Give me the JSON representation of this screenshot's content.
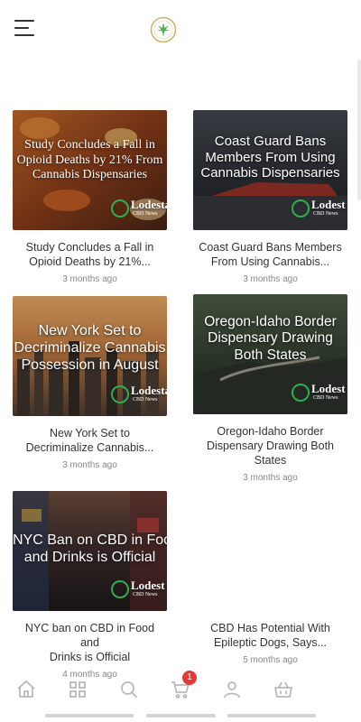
{
  "colors": {
    "accent": "#2fae4f",
    "badge": "#e53935",
    "icon": "#b9b9b9"
  },
  "header": {
    "menu_icon": "hamburger-menu-icon",
    "logo_icon": "cannabis-leaf-logo-icon"
  },
  "articles": [
    {
      "image_text": [
        "Study Concludes a Fall in",
        "Opioid Deaths by 21% From",
        "Cannabis Dispensaries"
      ],
      "brand": "Lodesta",
      "brand_sub": "CBD News",
      "title_lines": [
        "Study Concludes a Fall in",
        "Opioid Deaths by 21%..."
      ],
      "time": "3 months ago"
    },
    {
      "image_text": [
        "Coast Guard Bans",
        "Members From Using",
        "Cannabis Dispensaries"
      ],
      "brand": "Lodest",
      "brand_sub": "CBD News",
      "title_lines": [
        "Coast Guard Bans Members",
        "From Using Cannabis..."
      ],
      "time": "3 months ago"
    },
    {
      "image_text": [
        "New York Set to",
        "Decriminalize Cannabis",
        "Possession in August"
      ],
      "brand": "Lodesta",
      "brand_sub": "CBD News",
      "title_lines": [
        "New York Set to",
        "Decriminalize Cannabis..."
      ],
      "time": "3 months ago"
    },
    {
      "image_text": [
        "Oregon-Idaho Border",
        "Dispensary Drawing",
        "Both States"
      ],
      "brand": "Lodest",
      "brand_sub": "CBD News",
      "title_lines": [
        "Oregon-Idaho Border",
        "Dispensary Drawing Both",
        "States"
      ],
      "time": "3 months ago"
    },
    {
      "image_text": [
        "NYC Ban on CBD in Food",
        "and Drinks is Official"
      ],
      "brand": "Lodest",
      "brand_sub": "CBD News",
      "title_lines": [
        "NYC ban on CBD in Food and",
        "Drinks is Official"
      ],
      "time": "4 months ago"
    },
    {
      "title_lines": [
        "CBD Has Potential With",
        "Epileptic Dogs, Says..."
      ],
      "time": "5 months ago"
    }
  ],
  "tabbar": {
    "tabs": [
      "home-icon",
      "grid-categories-icon",
      "search-icon",
      "cart-icon",
      "profile-icon",
      "basket-icon"
    ],
    "cart_badge": "1"
  }
}
